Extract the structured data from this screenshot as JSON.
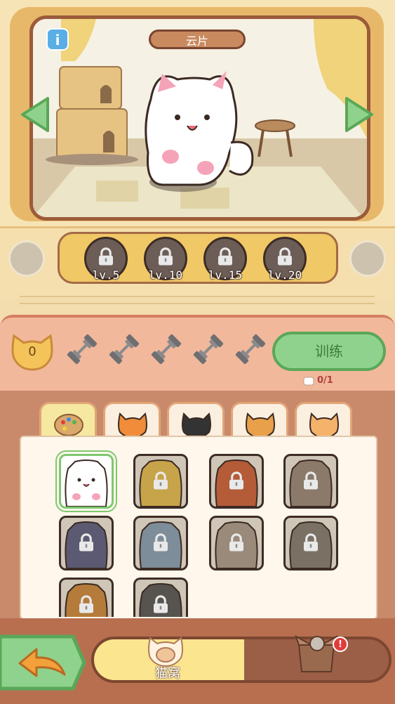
{
  "scene": {
    "cat_name": "云片",
    "info_label": "i"
  },
  "levels": [
    {
      "label": "lv.5"
    },
    {
      "label": "lv.10"
    },
    {
      "label": "lv.15"
    },
    {
      "label": "lv.20"
    }
  ],
  "training": {
    "score": "0",
    "button_label": "训练",
    "count": "0/1",
    "dumbbell_count": 5
  },
  "tabs": [
    {
      "icon": "palette-icon"
    },
    {
      "icon": "orange-cat-icon"
    },
    {
      "icon": "tuxedo-cat-icon"
    },
    {
      "icon": "calico-cat-icon"
    },
    {
      "icon": "ginger-tabby-cat-icon"
    }
  ],
  "cats": [
    {
      "color": "#ffffff",
      "locked": false,
      "selected": true
    },
    {
      "color": "#c7a34a",
      "locked": true
    },
    {
      "color": "#b45b38",
      "locked": true
    },
    {
      "color": "#8b7a6a",
      "locked": true
    },
    {
      "color": "#5b5a72",
      "locked": true
    },
    {
      "color": "#7d8d99",
      "locked": true
    },
    {
      "color": "#9a8a7a",
      "locked": true
    },
    {
      "color": "#7a7164",
      "locked": true
    },
    {
      "color": "#b47b3a",
      "locked": true
    },
    {
      "color": "#57534f",
      "locked": true
    }
  ],
  "bottom": {
    "nest_label": "猫窝",
    "alert": "!"
  },
  "colors": {
    "accent_green": "#8fd28d",
    "frame_brown": "#9b5b3a",
    "yellow": "#fbe58f"
  }
}
